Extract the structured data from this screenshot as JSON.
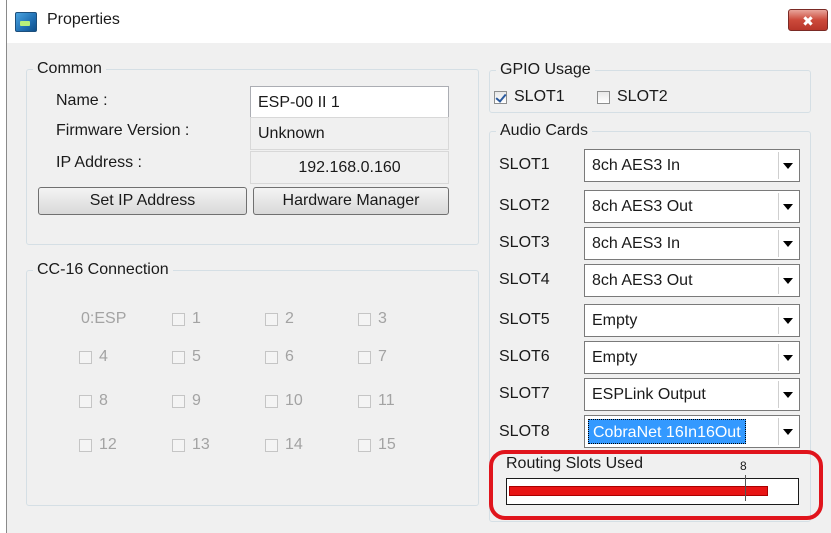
{
  "window": {
    "title": "Properties",
    "close_glyph": "✖"
  },
  "common": {
    "legend": "Common",
    "name_label": "Name :",
    "name_value": "ESP-00 II 1",
    "firmware_label": "Firmware Version :",
    "firmware_value": "Unknown",
    "ip_label": "IP Address :",
    "ip_value": "192.168.0.160",
    "set_ip_button": "Set IP Address",
    "hardware_manager_button": "Hardware Manager"
  },
  "cc16": {
    "legend": "CC-16 Connection",
    "esp_label": "0:ESP",
    "items": [
      {
        "label": "1",
        "checked": false
      },
      {
        "label": "2",
        "checked": false
      },
      {
        "label": "3",
        "checked": false
      },
      {
        "label": "4",
        "checked": false
      },
      {
        "label": "5",
        "checked": false
      },
      {
        "label": "6",
        "checked": false
      },
      {
        "label": "7",
        "checked": false
      },
      {
        "label": "8",
        "checked": false
      },
      {
        "label": "9",
        "checked": false
      },
      {
        "label": "10",
        "checked": false
      },
      {
        "label": "11",
        "checked": false
      },
      {
        "label": "12",
        "checked": false
      },
      {
        "label": "13",
        "checked": false
      },
      {
        "label": "14",
        "checked": false
      },
      {
        "label": "15",
        "checked": false
      }
    ]
  },
  "gpio": {
    "legend": "GPIO Usage",
    "slot1": {
      "label": "SLOT1",
      "checked": true
    },
    "slot2": {
      "label": "SLOT2",
      "checked": false
    }
  },
  "audio_cards": {
    "legend": "Audio Cards",
    "slots": [
      {
        "label": "SLOT1",
        "value": "8ch AES3 In"
      },
      {
        "label": "SLOT2",
        "value": "8ch AES3 Out"
      },
      {
        "label": "SLOT3",
        "value": "8ch AES3 In"
      },
      {
        "label": "SLOT4",
        "value": "8ch AES3 Out"
      },
      {
        "label": "SLOT5",
        "value": "Empty"
      },
      {
        "label": "SLOT6",
        "value": "Empty"
      },
      {
        "label": "SLOT7",
        "value": "ESPLink Output"
      },
      {
        "label": "SLOT8",
        "value": "CobraNet 16In16Out"
      }
    ]
  },
  "routing": {
    "label": "Routing Slots Used",
    "max_label": "8",
    "used_fraction": 0.99,
    "colors": {
      "fill": "#e81414",
      "highlight": "#e0141c"
    }
  }
}
